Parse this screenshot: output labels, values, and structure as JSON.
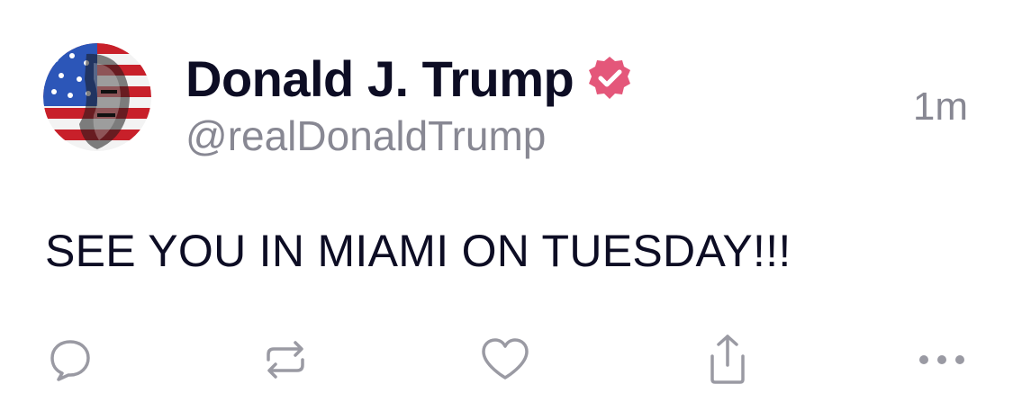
{
  "post": {
    "author": {
      "display_name": "Donald J. Trump",
      "handle": "@realDonaldTrump",
      "verified": true,
      "avatar_icon": "flag-portrait-avatar"
    },
    "timestamp": "1m",
    "text": "SEE YOU IN MIAMI ON TUESDAY!!!"
  },
  "actions": [
    {
      "name": "reply",
      "icon": "comment-bubble-icon"
    },
    {
      "name": "repost",
      "icon": "repost-arrows-icon"
    },
    {
      "name": "like",
      "icon": "heart-icon"
    },
    {
      "name": "share",
      "icon": "share-upload-icon"
    },
    {
      "name": "more",
      "icon": "ellipsis-icon"
    }
  ],
  "colors": {
    "name_text": "#0d0d24",
    "secondary_text": "#888893",
    "verified_badge": "#e4577a",
    "icon_gray": "#9a9aa3"
  }
}
